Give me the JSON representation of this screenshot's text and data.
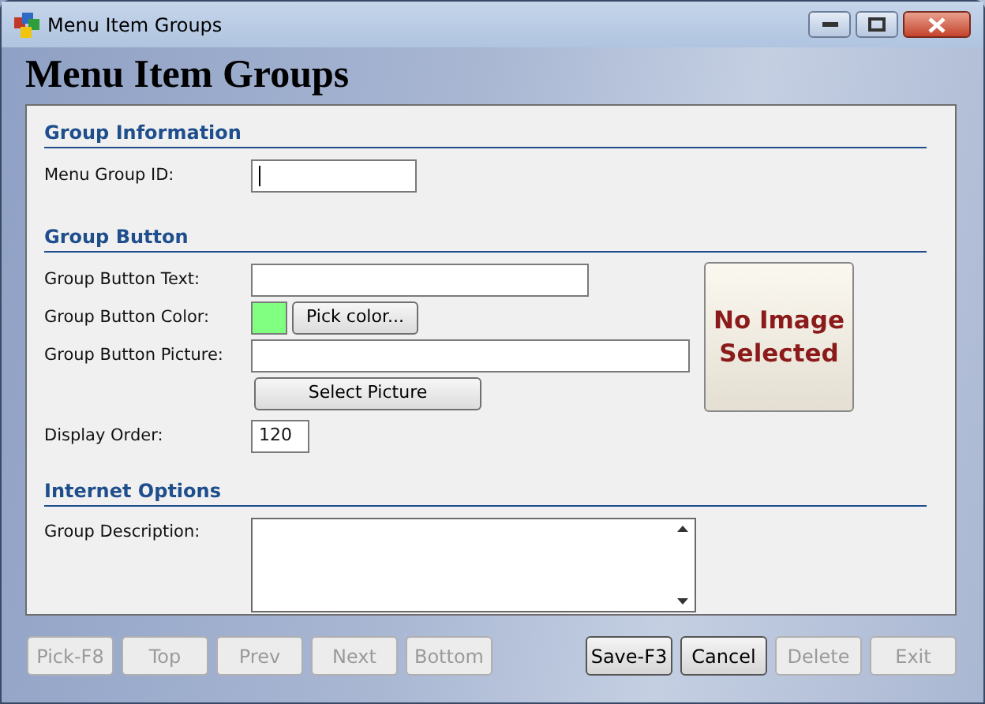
{
  "window": {
    "title": "Menu Item Groups"
  },
  "heading": "Menu Item Groups",
  "sections": [
    {
      "title": "Group Information",
      "fields": [
        {
          "kind": "text",
          "label": "Menu Group ID:",
          "focused": true
        }
      ]
    },
    {
      "title": "Group Button",
      "image_placeholder": "No Image Selected",
      "fields": [
        {
          "kind": "text",
          "label": "Group Button Text:",
          "focused": false
        },
        {
          "kind": "color",
          "label": "Group Button Color:",
          "color": "#80ff80",
          "button": "Pick color..."
        },
        {
          "kind": "text",
          "label": "Group Button Picture:",
          "focused": false
        },
        {
          "kind": "button",
          "button": "Select Picture"
        },
        {
          "kind": "text",
          "label": "Display Order:",
          "value": "120",
          "focused": false
        }
      ]
    },
    {
      "title": "Internet Options",
      "fields": [
        {
          "kind": "textarea",
          "label": "Group Description:"
        }
      ]
    }
  ],
  "nav_buttons": [
    {
      "label": "Pick-F8",
      "disabled": true
    },
    {
      "label": "Top",
      "disabled": true
    },
    {
      "label": "Prev",
      "disabled": true
    },
    {
      "label": "Next",
      "disabled": true
    },
    {
      "label": "Bottom",
      "disabled": true
    }
  ],
  "action_buttons": [
    {
      "label": "Save-F3",
      "disabled": false
    },
    {
      "label": "Cancel",
      "disabled": false
    },
    {
      "label": "Delete",
      "disabled": true
    },
    {
      "label": "Exit",
      "disabled": true
    }
  ]
}
